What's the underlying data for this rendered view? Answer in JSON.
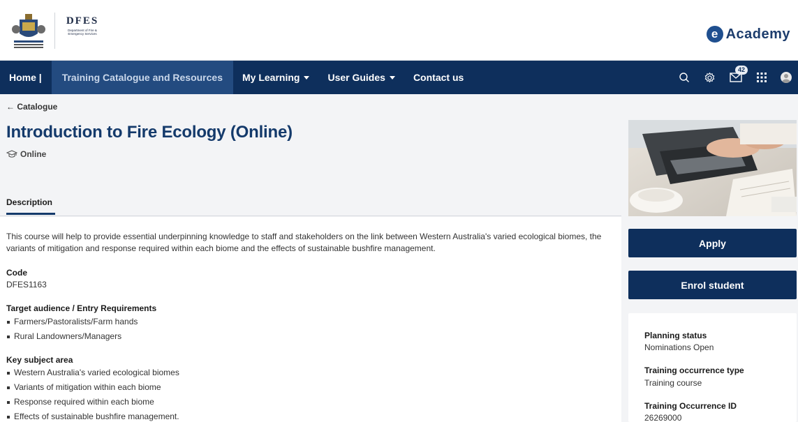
{
  "header": {
    "dfes_word": "DFES",
    "dfes_sub": "Department of Fire & Emergency Services",
    "academy_letter": "e",
    "academy_text": "Academy"
  },
  "nav": {
    "items": [
      {
        "label": "Home |",
        "active": false,
        "dropdown": false
      },
      {
        "label": "Training Catalogue and Resources",
        "active": true,
        "dropdown": false
      },
      {
        "label": "My Learning",
        "active": false,
        "dropdown": true
      },
      {
        "label": "User Guides",
        "active": false,
        "dropdown": true
      },
      {
        "label": "Contact us",
        "active": false,
        "dropdown": false
      }
    ],
    "icons": [
      "search-icon",
      "gear-icon",
      "mail-icon",
      "apps-grid-icon",
      "user-avatar-icon"
    ],
    "mail_badge": "42"
  },
  "page": {
    "back_link": "← Catalogue",
    "title": "Introduction to Fire Ecology (Online)",
    "delivery": "Online",
    "tab": "Description",
    "description": "This course will help to provide essential underpinning knowledge to staff and stakeholders on the link between Western Australia's varied ecological biomes, the variants of mitigation and response required within each biome and the effects of sustainable bushfire management.",
    "code_label": "Code",
    "code_value": "DFES1163",
    "audience_label": "Target audience / Entry Requirements",
    "audience_items": [
      "Farmers/Pastoralists/Farm hands",
      "Rural Landowners/Managers"
    ],
    "subject_label": "Key subject area",
    "subject_items": [
      "Western Australia's varied ecological biomes",
      "Variants of mitigation within each biome",
      "Response required within each biome",
      "Effects of sustainable bushfire management."
    ]
  },
  "sidebar": {
    "apply_label": "Apply",
    "enrol_label": "Enrol student",
    "planning_status_label": "Planning status",
    "planning_status_value": "Nominations Open",
    "occurrence_type_label": "Training occurrence type",
    "occurrence_type_value": "Training course",
    "occurrence_id_label": "Training Occurrence ID",
    "occurrence_id_value": "26269000"
  },
  "colors": {
    "nav_bg": "#0e2f5c",
    "nav_active": "#234b80",
    "title": "#143a6b",
    "button": "#0e2f5c"
  }
}
